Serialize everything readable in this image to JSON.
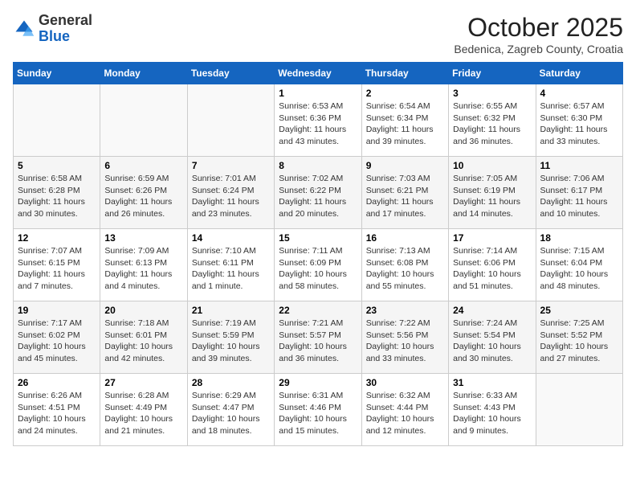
{
  "header": {
    "logo_general": "General",
    "logo_blue": "Blue",
    "month_title": "October 2025",
    "subtitle": "Bedenica, Zagreb County, Croatia"
  },
  "days_of_week": [
    "Sunday",
    "Monday",
    "Tuesday",
    "Wednesday",
    "Thursday",
    "Friday",
    "Saturday"
  ],
  "weeks": [
    [
      {
        "day": "",
        "info": ""
      },
      {
        "day": "",
        "info": ""
      },
      {
        "day": "",
        "info": ""
      },
      {
        "day": "1",
        "info": "Sunrise: 6:53 AM\nSunset: 6:36 PM\nDaylight: 11 hours and 43 minutes."
      },
      {
        "day": "2",
        "info": "Sunrise: 6:54 AM\nSunset: 6:34 PM\nDaylight: 11 hours and 39 minutes."
      },
      {
        "day": "3",
        "info": "Sunrise: 6:55 AM\nSunset: 6:32 PM\nDaylight: 11 hours and 36 minutes."
      },
      {
        "day": "4",
        "info": "Sunrise: 6:57 AM\nSunset: 6:30 PM\nDaylight: 11 hours and 33 minutes."
      }
    ],
    [
      {
        "day": "5",
        "info": "Sunrise: 6:58 AM\nSunset: 6:28 PM\nDaylight: 11 hours and 30 minutes."
      },
      {
        "day": "6",
        "info": "Sunrise: 6:59 AM\nSunset: 6:26 PM\nDaylight: 11 hours and 26 minutes."
      },
      {
        "day": "7",
        "info": "Sunrise: 7:01 AM\nSunset: 6:24 PM\nDaylight: 11 hours and 23 minutes."
      },
      {
        "day": "8",
        "info": "Sunrise: 7:02 AM\nSunset: 6:22 PM\nDaylight: 11 hours and 20 minutes."
      },
      {
        "day": "9",
        "info": "Sunrise: 7:03 AM\nSunset: 6:21 PM\nDaylight: 11 hours and 17 minutes."
      },
      {
        "day": "10",
        "info": "Sunrise: 7:05 AM\nSunset: 6:19 PM\nDaylight: 11 hours and 14 minutes."
      },
      {
        "day": "11",
        "info": "Sunrise: 7:06 AM\nSunset: 6:17 PM\nDaylight: 11 hours and 10 minutes."
      }
    ],
    [
      {
        "day": "12",
        "info": "Sunrise: 7:07 AM\nSunset: 6:15 PM\nDaylight: 11 hours and 7 minutes."
      },
      {
        "day": "13",
        "info": "Sunrise: 7:09 AM\nSunset: 6:13 PM\nDaylight: 11 hours and 4 minutes."
      },
      {
        "day": "14",
        "info": "Sunrise: 7:10 AM\nSunset: 6:11 PM\nDaylight: 11 hours and 1 minute."
      },
      {
        "day": "15",
        "info": "Sunrise: 7:11 AM\nSunset: 6:09 PM\nDaylight: 10 hours and 58 minutes."
      },
      {
        "day": "16",
        "info": "Sunrise: 7:13 AM\nSunset: 6:08 PM\nDaylight: 10 hours and 55 minutes."
      },
      {
        "day": "17",
        "info": "Sunrise: 7:14 AM\nSunset: 6:06 PM\nDaylight: 10 hours and 51 minutes."
      },
      {
        "day": "18",
        "info": "Sunrise: 7:15 AM\nSunset: 6:04 PM\nDaylight: 10 hours and 48 minutes."
      }
    ],
    [
      {
        "day": "19",
        "info": "Sunrise: 7:17 AM\nSunset: 6:02 PM\nDaylight: 10 hours and 45 minutes."
      },
      {
        "day": "20",
        "info": "Sunrise: 7:18 AM\nSunset: 6:01 PM\nDaylight: 10 hours and 42 minutes."
      },
      {
        "day": "21",
        "info": "Sunrise: 7:19 AM\nSunset: 5:59 PM\nDaylight: 10 hours and 39 minutes."
      },
      {
        "day": "22",
        "info": "Sunrise: 7:21 AM\nSunset: 5:57 PM\nDaylight: 10 hours and 36 minutes."
      },
      {
        "day": "23",
        "info": "Sunrise: 7:22 AM\nSunset: 5:56 PM\nDaylight: 10 hours and 33 minutes."
      },
      {
        "day": "24",
        "info": "Sunrise: 7:24 AM\nSunset: 5:54 PM\nDaylight: 10 hours and 30 minutes."
      },
      {
        "day": "25",
        "info": "Sunrise: 7:25 AM\nSunset: 5:52 PM\nDaylight: 10 hours and 27 minutes."
      }
    ],
    [
      {
        "day": "26",
        "info": "Sunrise: 6:26 AM\nSunset: 4:51 PM\nDaylight: 10 hours and 24 minutes."
      },
      {
        "day": "27",
        "info": "Sunrise: 6:28 AM\nSunset: 4:49 PM\nDaylight: 10 hours and 21 minutes."
      },
      {
        "day": "28",
        "info": "Sunrise: 6:29 AM\nSunset: 4:47 PM\nDaylight: 10 hours and 18 minutes."
      },
      {
        "day": "29",
        "info": "Sunrise: 6:31 AM\nSunset: 4:46 PM\nDaylight: 10 hours and 15 minutes."
      },
      {
        "day": "30",
        "info": "Sunrise: 6:32 AM\nSunset: 4:44 PM\nDaylight: 10 hours and 12 minutes."
      },
      {
        "day": "31",
        "info": "Sunrise: 6:33 AM\nSunset: 4:43 PM\nDaylight: 10 hours and 9 minutes."
      },
      {
        "day": "",
        "info": ""
      }
    ]
  ]
}
